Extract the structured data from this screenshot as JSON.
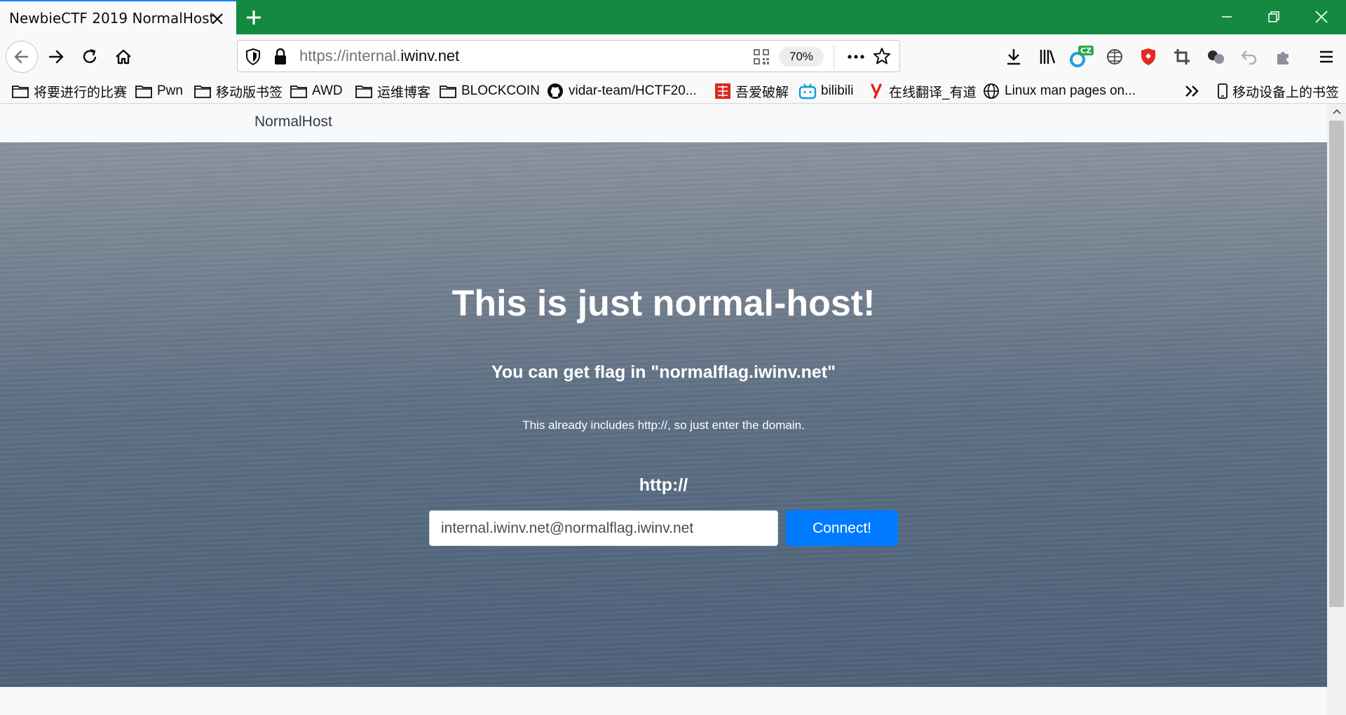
{
  "browser": {
    "tab": {
      "title": "NewbieCTF 2019 NormalHost"
    },
    "url": {
      "prefix": "https://internal.",
      "host": "iwinv.net"
    },
    "zoom": "70%",
    "bookmarks": [
      {
        "label": "将要进行的比赛",
        "icon": "folder-icon"
      },
      {
        "label": "Pwn",
        "icon": "folder-icon"
      },
      {
        "label": "移动版书签",
        "icon": "folder-icon"
      },
      {
        "label": "AWD",
        "icon": "folder-icon"
      },
      {
        "label": "运维博客",
        "icon": "folder-icon"
      },
      {
        "label": "BLOCKCOIN",
        "icon": "folder-icon"
      },
      {
        "label": "vidar-team/HCTF20...",
        "icon": "github-icon"
      },
      {
        "label": "吾爱破解",
        "icon": "52pojie-icon"
      },
      {
        "label": "bilibili",
        "icon": "bilibili-icon"
      },
      {
        "label": "在线翻译_有道",
        "icon": "youdao-icon"
      },
      {
        "label": "Linux man pages on...",
        "icon": "globe-icon"
      }
    ],
    "mobile_bookmarks": "移动设备上的书签",
    "extension_badge": "CZ"
  },
  "page": {
    "brand": "NormalHost",
    "title": "This is just normal-host!",
    "subtitle": "You can get flag in \"normalflag.iwinv.net\"",
    "note": "This already includes http://, so just enter the domain.",
    "protocol_label": "http://",
    "domain_input_value": "internal.iwinv.net@normalflag.iwinv.net",
    "connect_button": "Connect!"
  },
  "colors": {
    "tabstrip": "#148a40",
    "tab_accent": "#0a84ff",
    "button": "#007bff"
  }
}
